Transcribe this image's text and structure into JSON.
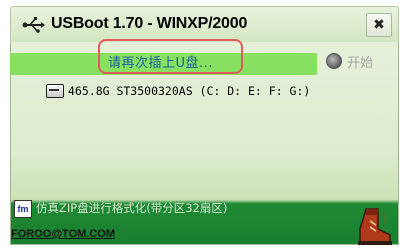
{
  "window": {
    "title": "USBoot 1.70 - WINXP/2000",
    "close_label": "✖"
  },
  "status": {
    "message": "请再次插上U盘...",
    "start_label": "开始"
  },
  "disks": [
    {
      "label": "465.8G ST3500320AS (C: D: E: F: G:)"
    }
  ],
  "footer": {
    "format_option": "仿真ZIP盘进行格式化(带分区32扇区)",
    "link": "FOROO@TOM.COM"
  },
  "icons": {
    "usb": "usb-plug-icon",
    "disk": "hard-disk-icon",
    "fm": "fm-logo-icon",
    "boot": "boot-icon"
  },
  "colors": {
    "status_bar": "#87e05f",
    "highlight": "#e05b5b",
    "status_text": "#1c5fa6"
  }
}
